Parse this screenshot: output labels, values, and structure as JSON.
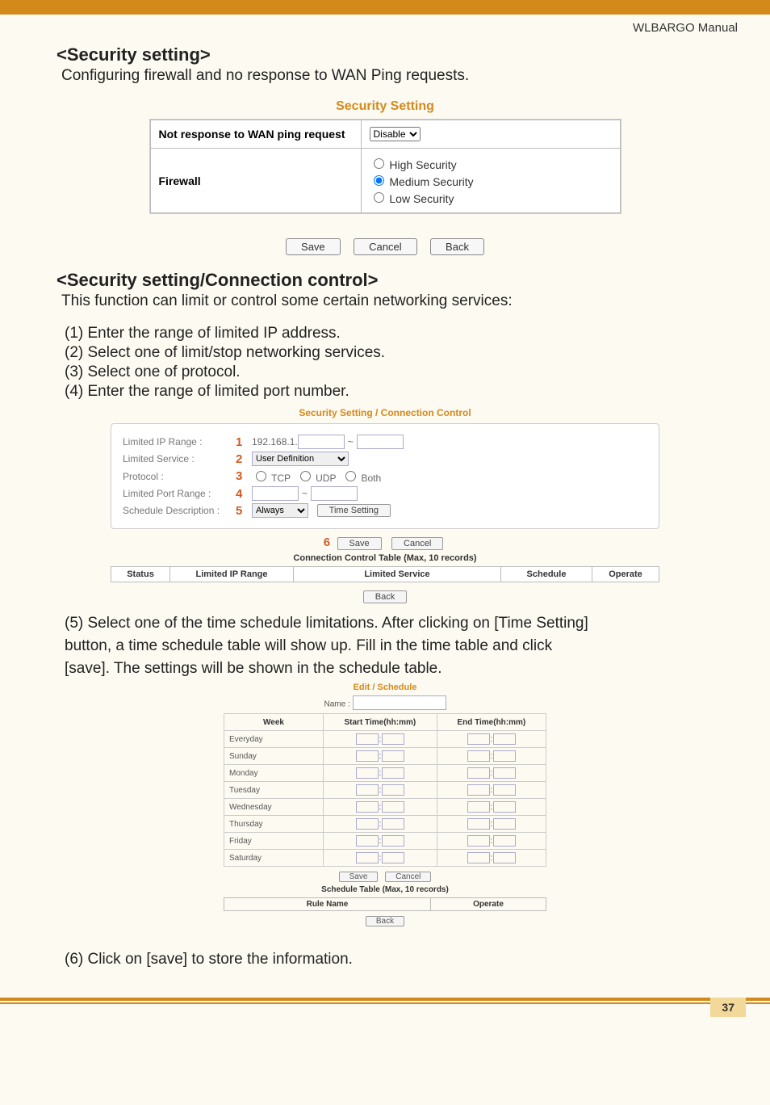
{
  "header": {
    "manual_title": "WLBARGO Manual"
  },
  "section1": {
    "heading": "<Security setting>",
    "desc": "Configuring firewall and no response to WAN Ping requests."
  },
  "fig_security": {
    "title": "Security Setting",
    "row1_label": "Not response to WAN ping request",
    "row1_select": "Disable",
    "row2_label": "Firewall",
    "opt_high": "High Security",
    "opt_medium": "Medium Security",
    "opt_low": "Low Security",
    "btn_save": "Save",
    "btn_cancel": "Cancel",
    "btn_back": "Back"
  },
  "section2": {
    "heading": "<Security setting/Connection control>",
    "desc": "This function can limit or control some certain networking services:",
    "steps": [
      "(1) Enter the range of limited IP address.",
      "(2) Select one of limit/stop networking services.",
      "(3) Select one of protocol.",
      "(4) Enter the range of limited port number."
    ]
  },
  "fig_cc": {
    "title": "Security Setting / Connection Control",
    "lbl_ip": "Limited IP Range :",
    "num1": "1",
    "ip_prefix": "192.168.1.",
    "lbl_service": "Limited Service :",
    "num2": "2",
    "service_select": "User Definition",
    "lbl_protocol": "Protocol :",
    "num3": "3",
    "proto_tcp": "TCP",
    "proto_udp": "UDP",
    "proto_both": "Both",
    "lbl_port": "Limited Port Range :",
    "num4": "4",
    "lbl_sched": "Schedule Description :",
    "num5": "5",
    "sched_select": "Always",
    "btn_time": "Time Setting",
    "num6": "6",
    "btn_save": "Save",
    "btn_cancel": "Cancel",
    "table_caption": "Connection Control Table (Max, 10 records)",
    "th_status": "Status",
    "th_ip": "Limited IP Range",
    "th_service": "Limited Service",
    "th_sched": "Schedule",
    "th_operate": "Operate",
    "btn_back": "Back"
  },
  "step5": {
    "line1": "(5) Select one of the time schedule limitations.  After clicking on [Time Setting]",
    "line2": "button, a time schedule table will show up. Fill in the time table and click",
    "line3": "[save]. The settings will be shown in the schedule table."
  },
  "fig_sched": {
    "title": "Edit / Schedule",
    "name_label": "Name :",
    "th_week": "Week",
    "th_start": "Start Time(hh:mm)",
    "th_end": "End Time(hh:mm)",
    "days": [
      "Everyday",
      "Sunday",
      "Monday",
      "Tuesday",
      "Wednesday",
      "Thursday",
      "Friday",
      "Saturday"
    ],
    "btn_save": "Save",
    "btn_cancel": "Cancel",
    "table_caption": "Schedule Table (Max, 10 records)",
    "th_rule": "Rule Name",
    "th_operate": "Operate",
    "btn_back": "Back"
  },
  "step6": "(6) Click on [save] to store the information.",
  "page_number": "37"
}
